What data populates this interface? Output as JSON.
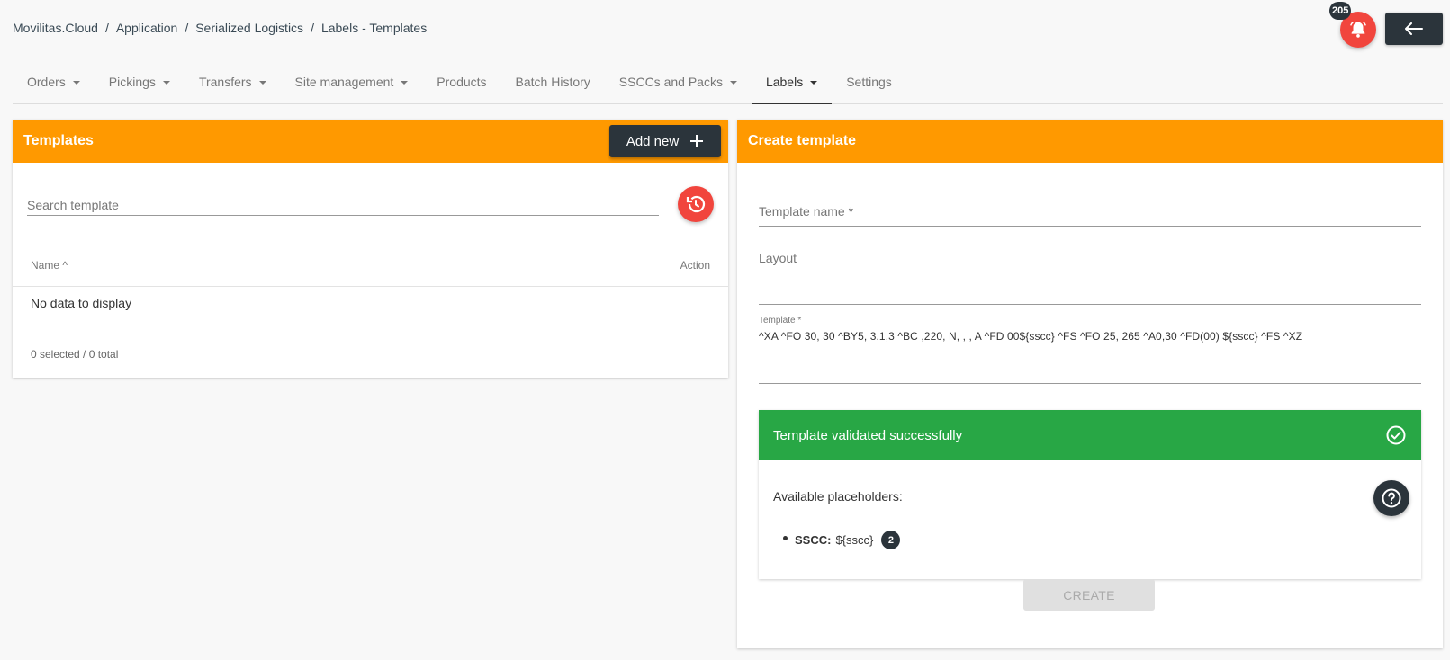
{
  "breadcrumb": [
    "Movilitas.Cloud",
    "Application",
    "Serialized Logistics",
    "Labels - Templates"
  ],
  "breadcrumb_separator": "/",
  "notifications": {
    "count": "205",
    "icon": "bell-icon",
    "color": "#f1453d"
  },
  "back_button": {
    "icon": "arrow-left-icon"
  },
  "tabs": [
    {
      "label": "Orders",
      "dropdown": true
    },
    {
      "label": "Pickings",
      "dropdown": true
    },
    {
      "label": "Transfers",
      "dropdown": true
    },
    {
      "label": "Site management",
      "dropdown": true
    },
    {
      "label": "Products",
      "dropdown": false
    },
    {
      "label": "Batch History",
      "dropdown": false
    },
    {
      "label": "SSCCs and Packs",
      "dropdown": true
    },
    {
      "label": "Labels",
      "dropdown": true,
      "active": true
    },
    {
      "label": "Settings",
      "dropdown": false
    }
  ],
  "templates_panel": {
    "title": "Templates",
    "add_new_label": "Add new",
    "search_placeholder": "Search template",
    "columns": {
      "name": "Name ^",
      "action": "Action"
    },
    "empty_text": "No data to display",
    "selection_summary": "0 selected / 0 total"
  },
  "create_panel": {
    "title": "Create template",
    "template_name_label": "Template name *",
    "layout_label": "Layout",
    "template_label": "Template *",
    "template_value": "^XA  ^FO 30, 30 ^BY5, 3.1,3 ^BC ,220, N, , , A ^FD 00${sscc} ^FS ^FO 25, 265 ^A0,30 ^FD(00) ${sscc} ^FS ^XZ",
    "validation_message": "Template validated successfully",
    "placeholders_title": "Available placeholders:",
    "placeholders": [
      {
        "key": "SSCC:",
        "value": "${sscc}",
        "count": "2"
      }
    ],
    "create_label": "CREATE"
  },
  "colors": {
    "header_orange": "#ff9900",
    "dark": "#2b343b",
    "red": "#f1453d",
    "success_green": "#28a745"
  }
}
